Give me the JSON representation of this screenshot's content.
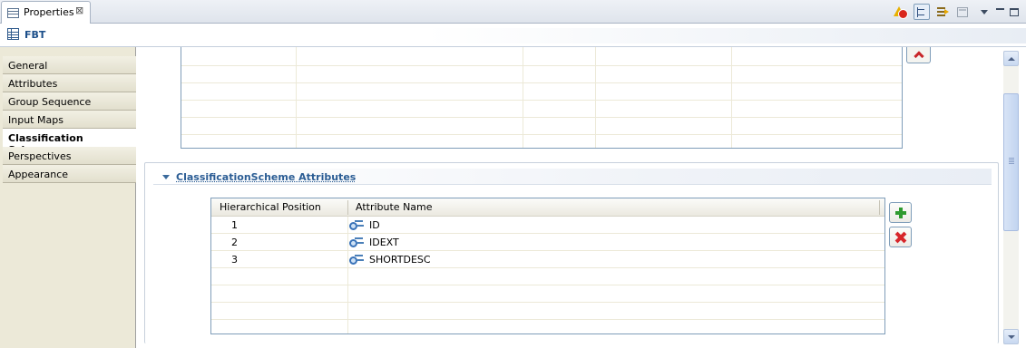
{
  "tabbar": {
    "view_tab_label": "Properties",
    "close_symbol": "⊠",
    "toolbar_icons": [
      "warnings-icon",
      "tree-icon",
      "filter-icon",
      "pin-icon",
      "view-menu-icon",
      "minimize-icon",
      "maximize-icon"
    ]
  },
  "header": {
    "title": "FBT",
    "icon": "table-icon"
  },
  "nav": {
    "items": [
      {
        "label": "General"
      },
      {
        "label": "Attributes"
      },
      {
        "label": "Group Sequence"
      },
      {
        "label": "Input Maps"
      },
      {
        "label": "Classification Schemes"
      },
      {
        "label": "Perspectives"
      },
      {
        "label": "Appearance"
      }
    ],
    "selected": "Classification Schemes"
  },
  "section": {
    "title": "ClassificationScheme Attributes",
    "expanded": true,
    "table": {
      "headers": [
        "Hierarchical Position",
        "Attribute Name"
      ],
      "rows": [
        {
          "position": "1",
          "name": "ID"
        },
        {
          "position": "2",
          "name": "IDEXT"
        },
        {
          "position": "3",
          "name": "SHORTDESC"
        }
      ]
    },
    "buttons": {
      "add": "add-icon",
      "remove": "remove-icon"
    }
  },
  "colors": {
    "accent": "#2a5c94",
    "nav_background": "#ece9d8",
    "border": "#7f9db9"
  }
}
